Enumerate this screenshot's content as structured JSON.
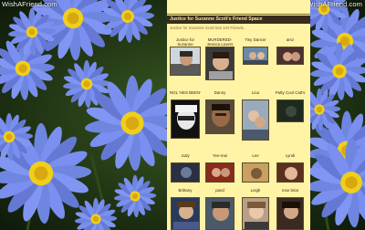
{
  "watermark": "WishAFriend.com",
  "section": {
    "title": "Justice for Suzanne Scott's Friend Space",
    "count_text": "Justice for Suzanne Scott has 144 Friends."
  },
  "friends": [
    {
      "name": "Justice for Suzanne",
      "photo_color": "#6a6a6a"
    },
    {
      "name": "MURDERED- Jessica Lovers",
      "photo_color": "#4a3a2a"
    },
    {
      "name": "Tiny Dancer",
      "photo_color": "#5a7a9a"
    },
    {
      "name": "amz",
      "photo_color": "#8a5a4a"
    },
    {
      "name": "NOL 'HES BEEN'",
      "photo_color": "#1a1a1a"
    },
    {
      "name": "Danny",
      "photo_color": "#3a2a1e"
    },
    {
      "name": "Lisa",
      "photo_color": "#7a8a9a"
    },
    {
      "name": "Patty Cool Catt's",
      "photo_color": "#2a3a2a"
    },
    {
      "name": "Judy",
      "photo_color": "#4a4a5a"
    },
    {
      "name": "Yee-mai",
      "photo_color": "#7a3a2a"
    },
    {
      "name": "Lee",
      "photo_color": "#8a6a3a"
    },
    {
      "name": "Lyndi",
      "photo_color": "#6a4a3a"
    },
    {
      "name": "Brittany",
      "photo_color": "#3a4a6a"
    },
    {
      "name": "pand",
      "photo_color": "#4a5a6a"
    },
    {
      "name": "Leigh",
      "photo_color": "#9a7a5a"
    },
    {
      "name": "rose briar",
      "photo_color": "#5a3a2a"
    }
  ]
}
